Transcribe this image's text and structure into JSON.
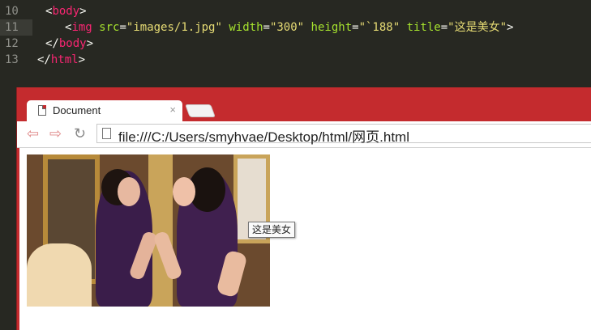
{
  "editor": {
    "lines": [
      {
        "num": "10",
        "t1": "<",
        "tag": "body",
        "t2": ">"
      },
      {
        "num": "11",
        "lt": "<",
        "tag": "img",
        "a1": "src",
        "eq1": "=",
        "v1": "\"images/1.jpg\"",
        "a2": "width",
        "eq2": "=",
        "v2": "\"300\"",
        "a3": "height",
        "eq3": "=",
        "v3": "\"`188\"",
        "a4": "title",
        "eq4": "=",
        "v4": "\"这是美女\"",
        "gt": ">"
      },
      {
        "num": "12",
        "t1": "</",
        "tag": "body",
        "t2": ">"
      },
      {
        "num": "13",
        "t1": "</",
        "tag": "html",
        "t2": ">"
      }
    ]
  },
  "browser": {
    "tab_title": "Document",
    "tab_close": "×",
    "nav_back": "⇦",
    "nav_forward": "⇨",
    "nav_reload": "↻",
    "url": "file:///C:/Users/smyhvae/Desktop/html/网页.html",
    "tooltip": "这是美女"
  },
  "colors": {
    "browser_frame": "#c42b2e",
    "editor_bg": "#272822"
  }
}
